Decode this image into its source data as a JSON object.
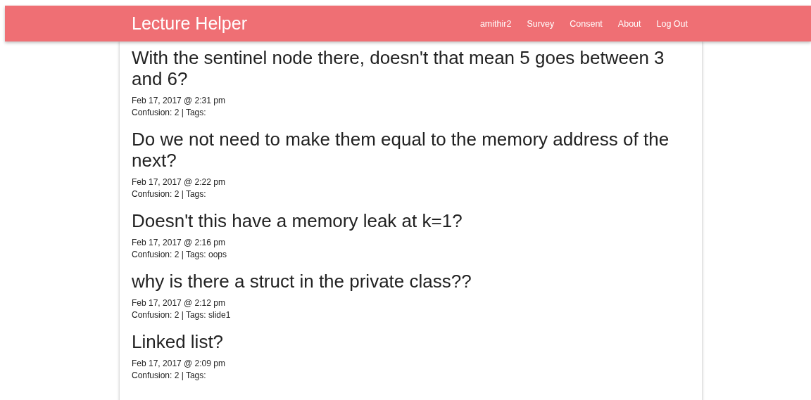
{
  "header": {
    "title": "Lecture Helper",
    "nav": [
      "amithir2",
      "Survey",
      "Consent",
      "About",
      "Log Out"
    ]
  },
  "questions": [
    {
      "text": "With the sentinel node there, doesn't that mean 5 goes between 3 and 6?",
      "date": "Feb 17, 2017 @ 2:31 pm",
      "meta": "Confusion: 2 | Tags:"
    },
    {
      "text": "Do we not need to make them equal to the memory address of the next?",
      "date": "Feb 17, 2017 @ 2:22 pm",
      "meta": "Confusion: 2 | Tags:"
    },
    {
      "text": "Doesn't this have a memory leak at k=1?",
      "date": "Feb 17, 2017 @ 2:16 pm",
      "meta": "Confusion: 2 | Tags: oops"
    },
    {
      "text": "why is there a struct in the private class??",
      "date": "Feb 17, 2017 @ 2:12 pm",
      "meta": "Confusion: 2 | Tags: slide1"
    },
    {
      "text": "Linked list?",
      "date": "Feb 17, 2017 @ 2:09 pm",
      "meta": "Confusion: 2 | Tags:"
    }
  ]
}
